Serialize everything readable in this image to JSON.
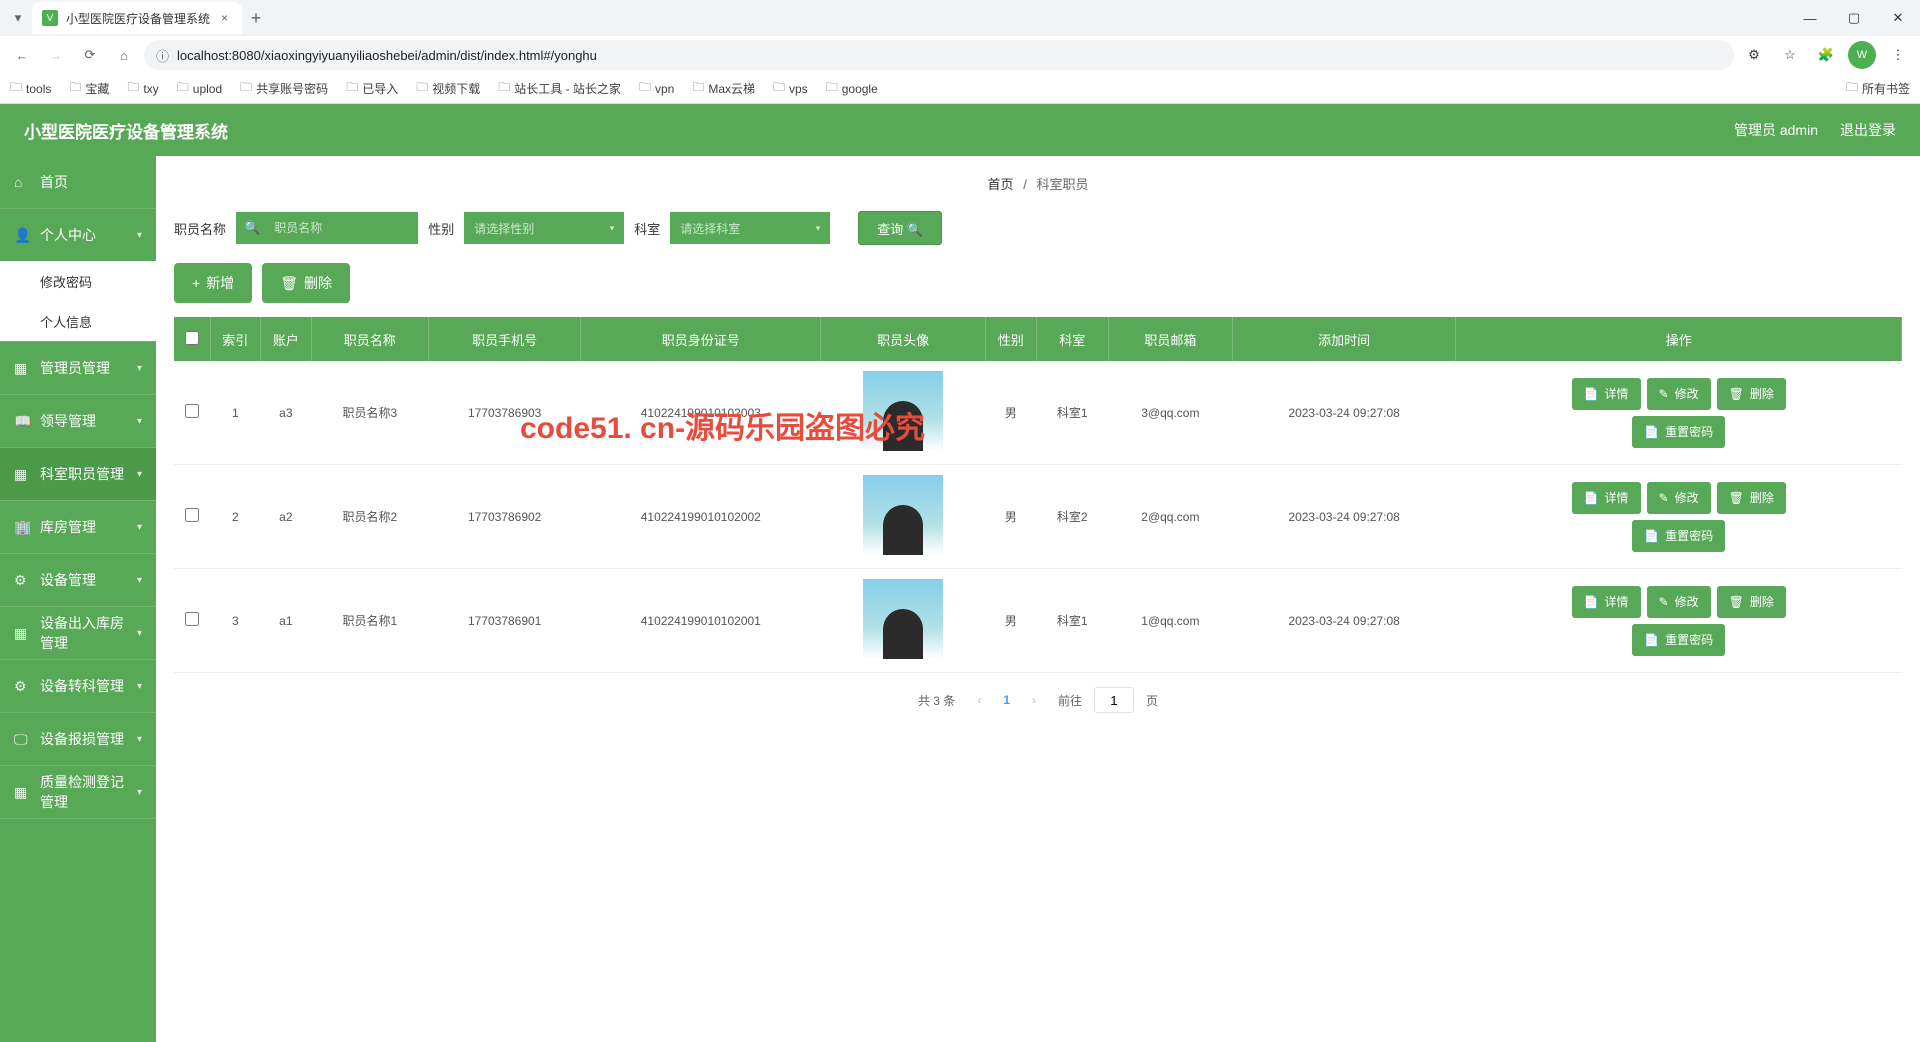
{
  "browser": {
    "tab_title": "小型医院医疗设备管理系统",
    "url": "localhost:8080/xiaoxingyiyuanyiliaoshebei/admin/dist/index.html#/yonghu",
    "profile_letter": "W",
    "all_bookmarks": "所有书签",
    "bookmarks": [
      "tools",
      "宝藏",
      "txy",
      "uplod",
      "共享账号密码",
      "已导入",
      "视频下载",
      "站长工具 - 站长之家",
      "vpn",
      "Max云梯",
      "vps",
      "google"
    ]
  },
  "app": {
    "title": "小型医院医疗设备管理系统",
    "user_label": "管理员 admin",
    "logout": "退出登录"
  },
  "sidebar": {
    "home": "首页",
    "personal": "个人中心",
    "sub_changepw": "修改密码",
    "sub_profile": "个人信息",
    "admin": "管理员管理",
    "leader": "领导管理",
    "dept_staff": "科室职员管理",
    "storeroom": "库房管理",
    "device": "设备管理",
    "inout": "设备出入库房管理",
    "transfer": "设备转科管理",
    "damage": "设备报损管理",
    "quality": "质量检测登记管理"
  },
  "breadcrumb": {
    "home": "首页",
    "sep": "/",
    "current": "科室职员"
  },
  "search": {
    "name_label": "职员名称",
    "name_placeholder": "职员名称",
    "gender_label": "性别",
    "gender_placeholder": "请选择性别",
    "dept_label": "科室",
    "dept_placeholder": "请选择科室",
    "button": "查询"
  },
  "actions": {
    "add": "新增",
    "delete": "删除"
  },
  "table": {
    "headers": [
      "",
      "索引",
      "账户",
      "职员名称",
      "职员手机号",
      "职员身份证号",
      "职员头像",
      "性别",
      "科室",
      "职员邮箱",
      "添加时间",
      "操作"
    ],
    "rows": [
      {
        "idx": "1",
        "acct": "a3",
        "name": "职员名称3",
        "phone": "17703786903",
        "idcard": "410224199010102003",
        "gender": "男",
        "dept": "科室1",
        "email": "3@qq.com",
        "time": "2023-03-24 09:27:08"
      },
      {
        "idx": "2",
        "acct": "a2",
        "name": "职员名称2",
        "phone": "17703786902",
        "idcard": "410224199010102002",
        "gender": "男",
        "dept": "科室2",
        "email": "2@qq.com",
        "time": "2023-03-24 09:27:08"
      },
      {
        "idx": "3",
        "acct": "a1",
        "name": "职员名称1",
        "phone": "17703786901",
        "idcard": "410224199010102001",
        "gender": "男",
        "dept": "科室1",
        "email": "1@qq.com",
        "time": "2023-03-24 09:27:08"
      }
    ],
    "ops": {
      "detail": "详情",
      "edit": "修改",
      "delete": "删除",
      "reset": "重置密码"
    }
  },
  "pagination": {
    "total": "共 3 条",
    "current": "1",
    "goto_prefix": "前往",
    "goto_page": "1",
    "goto_suffix": "页"
  },
  "watermark": "code51.cn",
  "watermark_red": "code51. cn-源码乐园盗图必究"
}
